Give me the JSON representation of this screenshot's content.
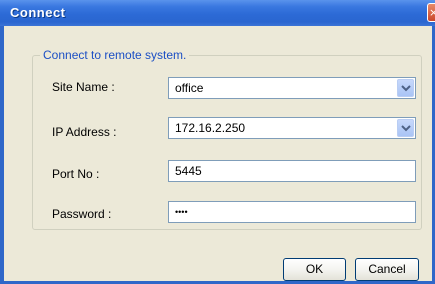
{
  "window": {
    "title": "Connect",
    "close_glyph": "×"
  },
  "group": {
    "legend": "Connect to remote system."
  },
  "fields": {
    "site_name": {
      "label": "Site Name :",
      "value": "office"
    },
    "ip_address": {
      "label": "IP Address :",
      "value": "172.16.2.250"
    },
    "port": {
      "label": "Port No :",
      "value": "5445"
    },
    "password": {
      "label": "Password :",
      "value": "••••"
    }
  },
  "buttons": {
    "ok_label": "OK",
    "cancel_label": "Cancel"
  },
  "colors": {
    "title_bar": "#2c6ad6",
    "group_legend": "#1c4fc4",
    "dialog_background": "#ece9d8"
  },
  "icons": {
    "dropdown": "chevron-down-icon",
    "close": "close-icon"
  }
}
